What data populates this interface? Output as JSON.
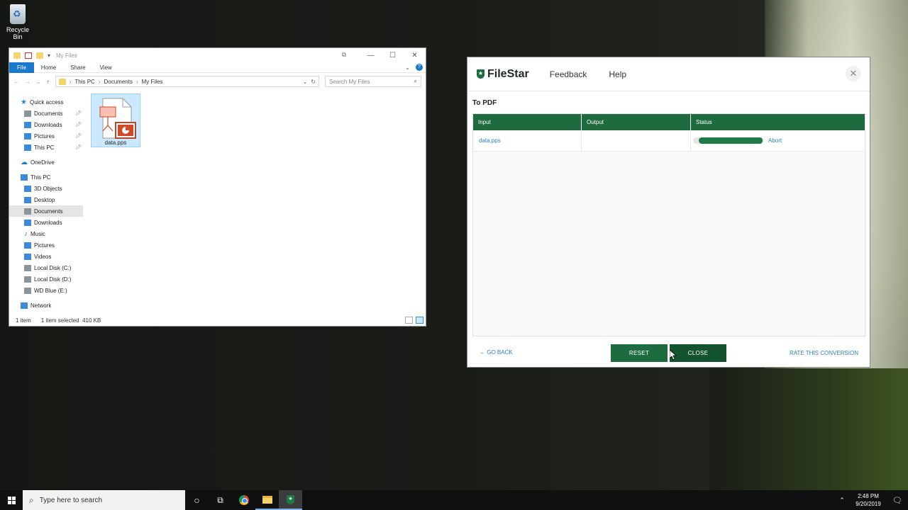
{
  "desktop": {
    "recycle_bin_label": "Recycle Bin"
  },
  "explorer": {
    "title": "My Files",
    "ribbon": {
      "file": "File",
      "home": "Home",
      "share": "Share",
      "view": "View"
    },
    "breadcrumb": [
      "This PC",
      "Documents",
      "My Files"
    ],
    "search_placeholder": "Search My Files",
    "nav": {
      "quick_access": "Quick access",
      "quick_items": [
        "Documents",
        "Downloads",
        "Pictures",
        "This PC"
      ],
      "onedrive": "OneDrive",
      "this_pc": "This PC",
      "pc_items": [
        "3D Objects",
        "Desktop",
        "Documents",
        "Downloads",
        "Music",
        "Pictures",
        "Videos",
        "Local Disk (C:)",
        "Local Disk (D:)",
        "WD Blue (E:)"
      ],
      "network": "Network"
    },
    "file": {
      "name": "data.pps"
    },
    "status": {
      "count": "1 item",
      "selected": "1 item selected",
      "size": "410 KB"
    }
  },
  "filestar": {
    "brand": "FileStar",
    "nav": {
      "feedback": "Feedback",
      "help": "Help"
    },
    "section_title": "To PDF",
    "table": {
      "headers": {
        "input": "Input",
        "output": "Output",
        "status": "Status"
      },
      "rows": [
        {
          "input": "data.pps",
          "output": "",
          "progress": 1.0,
          "action": "Abort"
        }
      ]
    },
    "footer": {
      "go_back": "GO BACK",
      "reset": "RESET",
      "close": "CLOSE",
      "rate": "RATE THIS CONVERSION"
    },
    "colors": {
      "primary": "#1e6b3f",
      "dark": "#13532d",
      "link": "#2d7fc4"
    }
  },
  "taskbar": {
    "search_placeholder": "Type here to search",
    "time": "2:48 PM",
    "date": "9/20/2019"
  }
}
